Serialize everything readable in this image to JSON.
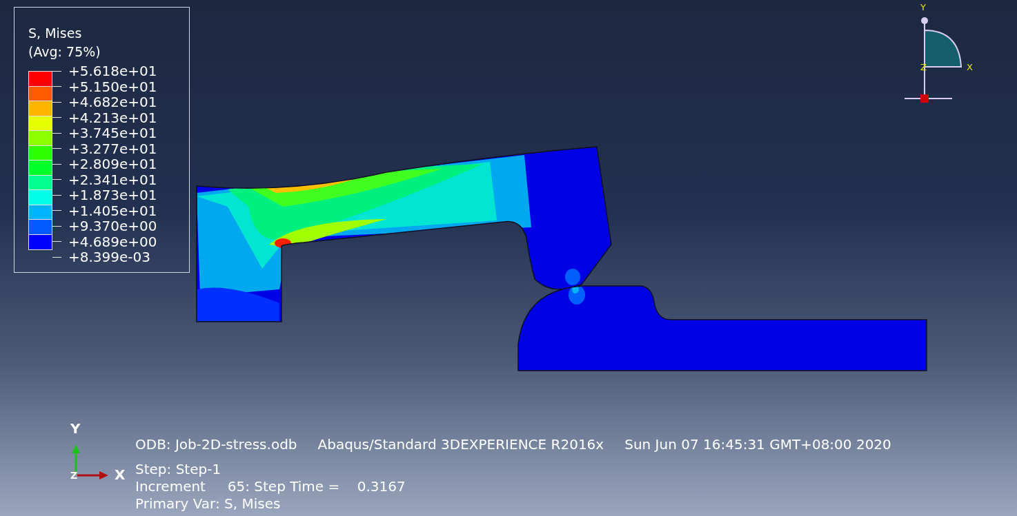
{
  "legend": {
    "title": "S, Mises",
    "subtitle": "(Avg: 75%)",
    "bands": [
      {
        "color": "#ff0000"
      },
      {
        "color": "#ff5a00"
      },
      {
        "color": "#ffb400"
      },
      {
        "color": "#e6ff00"
      },
      {
        "color": "#8cff00"
      },
      {
        "color": "#2dff00"
      },
      {
        "color": "#00ff28"
      },
      {
        "color": "#00ff8c"
      },
      {
        "color": "#00ffe6"
      },
      {
        "color": "#00b4ff"
      },
      {
        "color": "#005aff"
      },
      {
        "color": "#0000ff"
      }
    ],
    "labels": [
      "+5.618e+01",
      "+5.150e+01",
      "+4.682e+01",
      "+4.213e+01",
      "+3.745e+01",
      "+3.277e+01",
      "+2.809e+01",
      "+2.341e+01",
      "+1.873e+01",
      "+1.405e+01",
      "+9.370e+00",
      "+4.689e+00",
      "+8.399e-03"
    ]
  },
  "view_triad": {
    "y_label": "Y",
    "z_label": "Z",
    "x_label": "X"
  },
  "axis_triad": {
    "y_label": "Y",
    "z_label": "Z",
    "x_label": "X"
  },
  "info": {
    "header": [
      "ODB: Job-2D-stress.odb",
      "Abaqus/Standard 3DEXPERIENCE R2016x",
      "Sun Jun 07 16:45:31 GMT+08:00 2020"
    ],
    "lines": [
      "Step: Step-1",
      "Increment     65: Step Time =    0.3167",
      "Primary Var: S, Mises"
    ]
  }
}
